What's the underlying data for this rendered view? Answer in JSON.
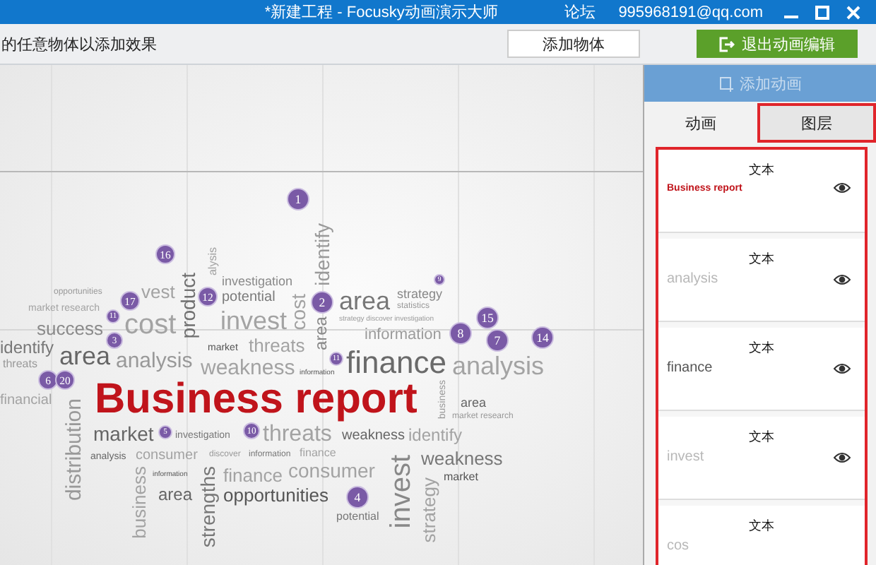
{
  "window": {
    "title": "*新建工程 - Focusky动画演示大师",
    "forum": "论坛",
    "account": "995968191@qq.com"
  },
  "toolbar": {
    "hint": "的任意物体以添加效果",
    "add_object": "添加物体",
    "exit_button": "退出动画编辑"
  },
  "canvas": {
    "words": [
      {
        "text": "product",
        "kind": "v"
      },
      {
        "text": "alysis",
        "kind": "v"
      },
      {
        "text": "investigation",
        "kind": "h"
      },
      {
        "text": "identify",
        "kind": "v"
      },
      {
        "text": "opportunities",
        "kind": "h"
      },
      {
        "text": "market research",
        "kind": "h"
      },
      {
        "text": "vest",
        "kind": "h"
      },
      {
        "text": "potential",
        "kind": "h"
      },
      {
        "text": "cost",
        "kind": "v"
      },
      {
        "text": "area",
        "kind": "h"
      },
      {
        "text": "strategy",
        "kind": "h"
      },
      {
        "text": "statistics",
        "kind": "h"
      },
      {
        "text": "identify",
        "kind": "h"
      },
      {
        "text": "success",
        "kind": "h"
      },
      {
        "text": "cost",
        "kind": "h"
      },
      {
        "text": "invest",
        "kind": "h"
      },
      {
        "text": "market",
        "kind": "h"
      },
      {
        "text": "threats",
        "kind": "h"
      },
      {
        "text": "area",
        "kind": "v"
      },
      {
        "text": "strategy discover investigation",
        "kind": "h"
      },
      {
        "text": "information",
        "kind": "h"
      },
      {
        "text": "threats",
        "kind": "h"
      },
      {
        "text": "area",
        "kind": "h"
      },
      {
        "text": "analysis",
        "kind": "h"
      },
      {
        "text": "weakness",
        "kind": "h"
      },
      {
        "text": "information",
        "kind": "h"
      },
      {
        "text": "finance",
        "kind": "h"
      },
      {
        "text": "analysis",
        "kind": "h"
      },
      {
        "text": "financial",
        "kind": "h"
      },
      {
        "text": "distribution",
        "kind": "v"
      },
      {
        "text": "Business report",
        "kind": "h"
      },
      {
        "text": "business",
        "kind": "v"
      },
      {
        "text": "market research",
        "kind": "h"
      },
      {
        "text": "area",
        "kind": "h"
      },
      {
        "text": "market",
        "kind": "h"
      },
      {
        "text": "investigation",
        "kind": "h"
      },
      {
        "text": "threats",
        "kind": "h"
      },
      {
        "text": "weakness",
        "kind": "h"
      },
      {
        "text": "identify",
        "kind": "h"
      },
      {
        "text": "analysis",
        "kind": "h"
      },
      {
        "text": "consumer",
        "kind": "h"
      },
      {
        "text": "discover",
        "kind": "h"
      },
      {
        "text": "information",
        "kind": "h"
      },
      {
        "text": "consumer",
        "kind": "h"
      },
      {
        "text": "finance",
        "kind": "h"
      },
      {
        "text": "business",
        "kind": "v"
      },
      {
        "text": "information",
        "kind": "h"
      },
      {
        "text": "area",
        "kind": "h"
      },
      {
        "text": "strengths",
        "kind": "v"
      },
      {
        "text": "finance",
        "kind": "h"
      },
      {
        "text": "opportunities",
        "kind": "h"
      },
      {
        "text": "potential",
        "kind": "h"
      },
      {
        "text": "invest",
        "kind": "v"
      },
      {
        "text": "strategy",
        "kind": "v"
      },
      {
        "text": "weakness",
        "kind": "h"
      },
      {
        "text": "market",
        "kind": "h"
      }
    ],
    "markers": [
      "1",
      "16",
      "12",
      "17",
      "11",
      "3",
      "6",
      "20",
      "2",
      "9",
      "15",
      "8",
      "7",
      "14",
      "11",
      "5",
      "10",
      "4"
    ]
  },
  "panel": {
    "add_animation": {
      "label": "添加动画",
      "disabled": true
    },
    "tabs": [
      {
        "label": "动画",
        "selected": false
      },
      {
        "label": "图层",
        "selected": true
      }
    ],
    "layers": [
      {
        "title": "文本",
        "preview": "Business report",
        "kind": "title",
        "visible": true
      },
      {
        "title": "文本",
        "preview": "analysis",
        "kind": "light",
        "visible": true
      },
      {
        "title": "文本",
        "preview": "finance",
        "kind": "dark",
        "visible": true
      },
      {
        "title": "文本",
        "preview": "invest",
        "kind": "light",
        "visible": true
      },
      {
        "title": "文本",
        "preview": "cos",
        "kind": "light",
        "visible": false
      }
    ]
  }
}
